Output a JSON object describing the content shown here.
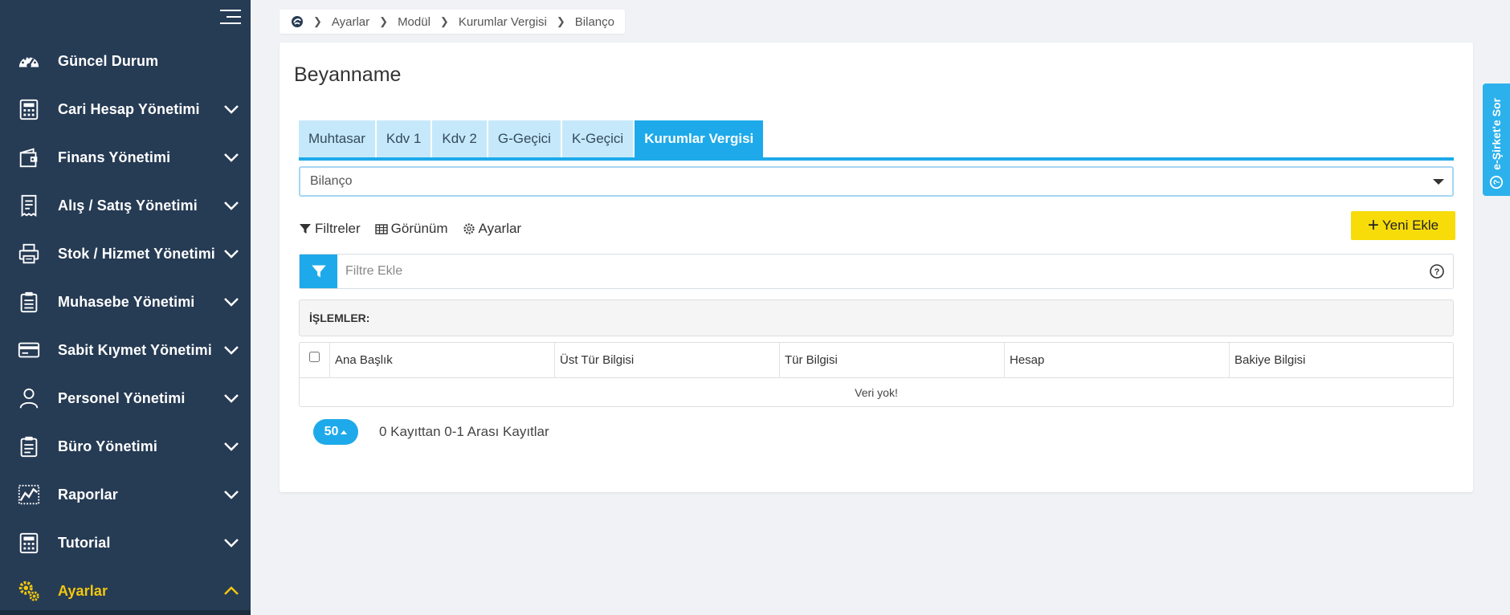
{
  "sidebar": {
    "items": [
      {
        "label": "Güncel Durum",
        "icon": "dashboard-gauge-icon",
        "has_children": false
      },
      {
        "label": "Cari Hesap Yönetimi",
        "icon": "calculator-icon",
        "has_children": true
      },
      {
        "label": "Finans Yönetimi",
        "icon": "wallet-icon",
        "has_children": true
      },
      {
        "label": "Alış / Satış Yönetimi",
        "icon": "receipt-icon",
        "has_children": true
      },
      {
        "label": "Stok / Hizmet Yönetimi",
        "icon": "printer-icon",
        "has_children": true
      },
      {
        "label": "Muhasebe Yönetimi",
        "icon": "clipboard-icon",
        "has_children": true
      },
      {
        "label": "Sabit Kıymet Yönetimi",
        "icon": "credit-card-icon",
        "has_children": true
      },
      {
        "label": "Personel Yönetimi",
        "icon": "user-icon",
        "has_children": true
      },
      {
        "label": "Büro Yönetimi",
        "icon": "clipboard-list-icon",
        "has_children": true
      },
      {
        "label": "Raporlar",
        "icon": "line-chart-icon",
        "has_children": true
      },
      {
        "label": "Tutorial",
        "icon": "calculator-icon",
        "has_children": true
      },
      {
        "label": "Ayarlar",
        "icon": "gears-icon",
        "has_children": true,
        "active": true
      }
    ]
  },
  "breadcrumb": {
    "items": [
      "Ayarlar",
      "Modül",
      "Kurumlar Vergisi",
      "Bilanço"
    ]
  },
  "page": {
    "title": "Beyanname"
  },
  "tabs": [
    {
      "label": "Muhtasar",
      "active": false
    },
    {
      "label": "Kdv 1",
      "active": false
    },
    {
      "label": "Kdv 2",
      "active": false
    },
    {
      "label": "G-Geçici",
      "active": false
    },
    {
      "label": "K-Geçici",
      "active": false
    },
    {
      "label": "Kurumlar Vergisi",
      "active": true
    }
  ],
  "select": {
    "value": "Bilanço"
  },
  "toolbar": {
    "filters_label": "Filtreler",
    "view_label": "Görünüm",
    "settings_label": "Ayarlar",
    "new_label": "Yeni Ekle"
  },
  "filter": {
    "placeholder": "Filtre Ekle"
  },
  "operations": {
    "label": "İŞLEMLER:"
  },
  "table": {
    "columns": [
      "Ana Başlık",
      "Üst Tür Bilgisi",
      "Tür Bilgisi",
      "Hesap",
      "Bakiye Bilgisi"
    ],
    "empty_text": "Veri yok!"
  },
  "pager": {
    "page_size": "50",
    "record_info": "0 Kayıttan 0-1 Arası Kayıtlar"
  },
  "side_tab": {
    "label": "e-Şirket'e Sor"
  },
  "colors": {
    "sidebar_bg": "#263b54",
    "accent_blue": "#1eaaea",
    "tab_inactive": "#c5e9fa",
    "active_yellow": "#f2c70f",
    "new_button": "#f7dc0a"
  }
}
